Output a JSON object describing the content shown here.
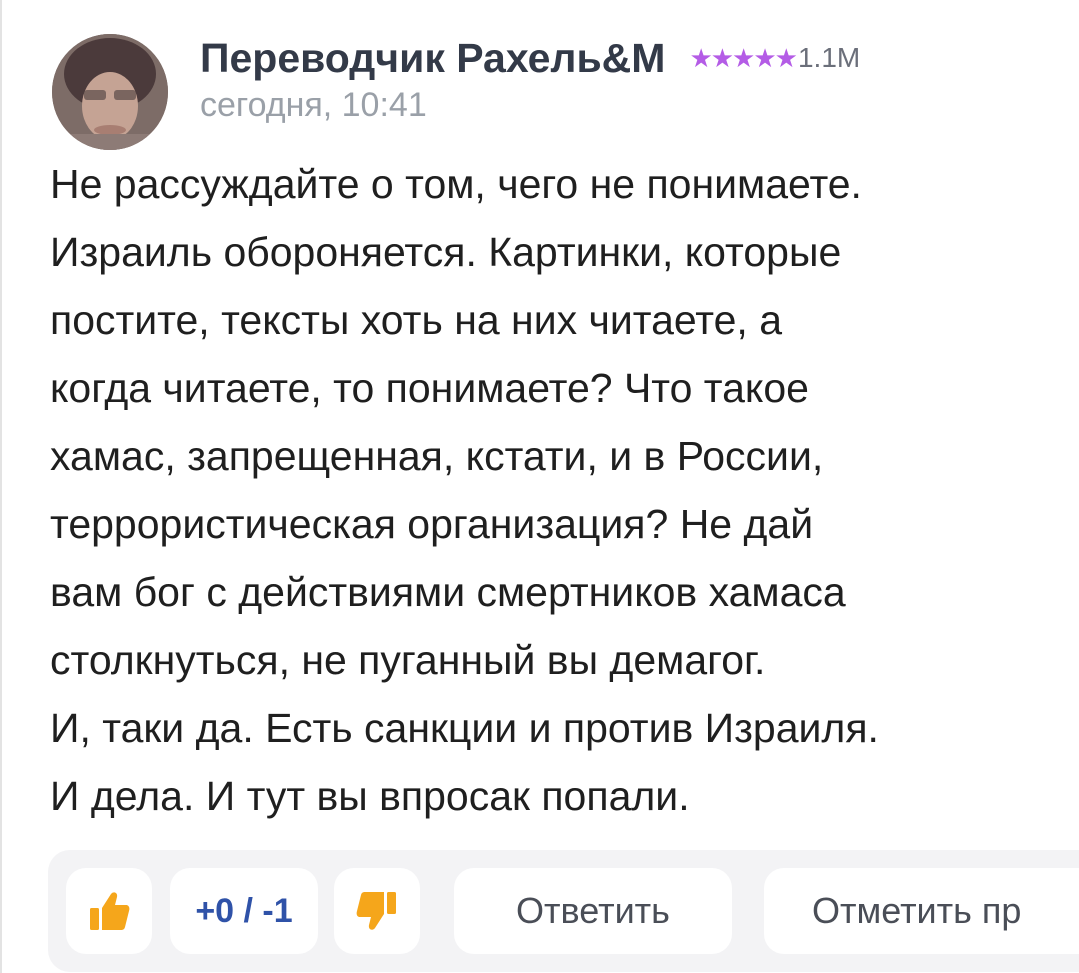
{
  "author": {
    "name": "Переводчик Рахель&M",
    "stars": "★★★★★",
    "rating": "1.1M",
    "timestamp": "сегодня, 10:41"
  },
  "comment": {
    "lines": [
      "Не рассуждайте о том, чего не понимаете.",
      "Израиль обороняется. Картинки, которые",
      "постите, тексты хоть на них читаете, а",
      "когда читаете, то понимаете? Что такое",
      "хамас, запрещенная, кстати, и в России,",
      "террористическая организация? Не дай",
      "вам бог с действиями смертников хамаса",
      "столкнуться, не пуганный вы демагог.",
      "И, таки да. Есть санкции и против Израиля.",
      "И дела. И тут вы впросак попали."
    ]
  },
  "actions": {
    "score": "+0 / -1",
    "reply_label": "Ответить",
    "mark_label": "Отметить пр"
  },
  "colors": {
    "author": "#333a48",
    "stars": "#b45ce6",
    "timestamp": "#9aa0a8",
    "score": "#2f52a8",
    "thumb": "#f5a61b",
    "bar_bg": "#f3f3f5"
  },
  "icons": {
    "like": "thumbs-up-icon",
    "dislike": "thumbs-down-icon"
  }
}
